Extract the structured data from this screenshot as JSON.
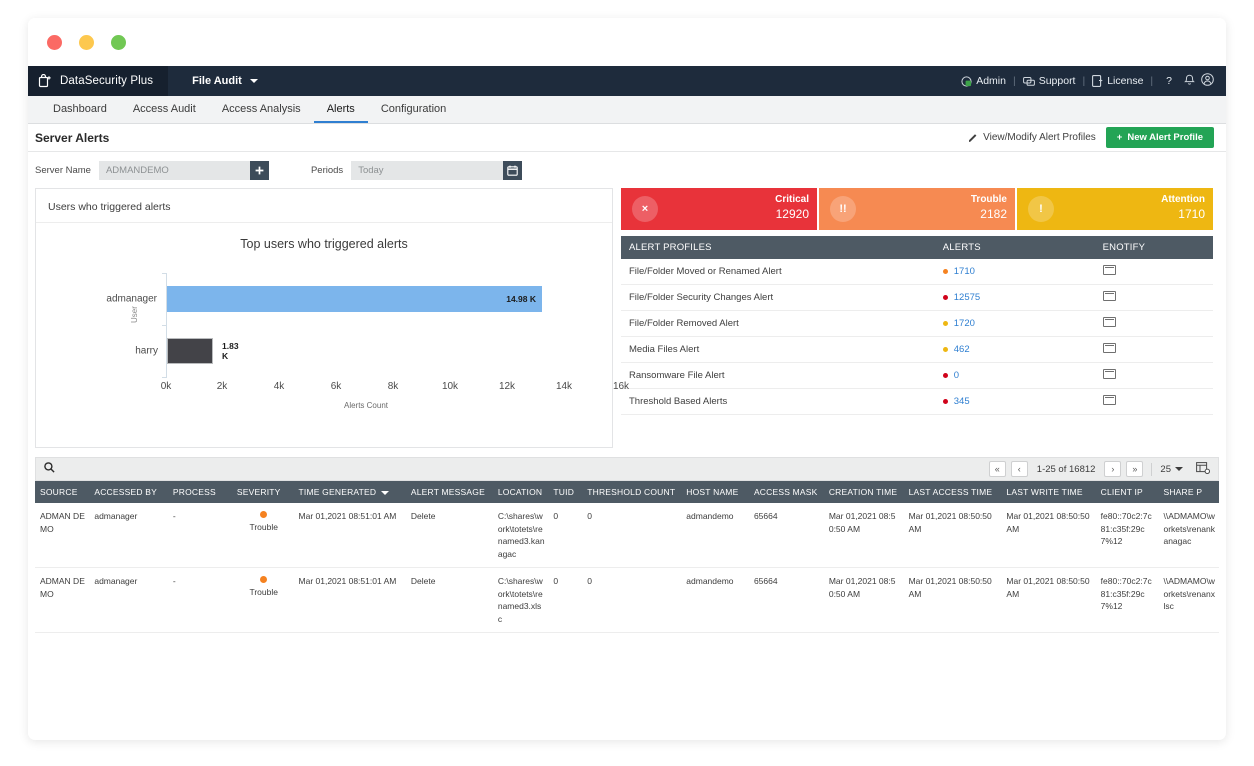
{
  "window": {
    "controls": [
      "close",
      "minimize",
      "maximize"
    ]
  },
  "appbar": {
    "brand": "DataSecurity Plus",
    "module": "File Audit",
    "right_items": [
      {
        "label": "Admin",
        "icon": "admin-icon"
      },
      {
        "label": "Support",
        "icon": "support-icon"
      },
      {
        "label": "License",
        "icon": "license-icon"
      }
    ],
    "help_icon": "?",
    "bell_icon": "bell-icon",
    "user_icon": "user-icon"
  },
  "tabs": [
    {
      "label": "Dashboard",
      "active": false
    },
    {
      "label": "Access Audit",
      "active": false
    },
    {
      "label": "Access Analysis",
      "active": false
    },
    {
      "label": "Alerts",
      "active": true
    },
    {
      "label": "Configuration",
      "active": false
    }
  ],
  "page": {
    "title": "Server Alerts",
    "view_modify_label": "View/Modify Alert Profiles",
    "new_profile_label": "New Alert Profile",
    "accent_green": "#23a455"
  },
  "filters": {
    "server_label": "Server Name",
    "server_value": "ADMANDEMO",
    "server_add_label": "+",
    "periods_label": "Periods",
    "periods_value": "Today"
  },
  "chart_card": {
    "title": "Users who triggered alerts"
  },
  "chart_data": {
    "type": "bar",
    "orientation": "horizontal",
    "title": "Top users who triggered alerts",
    "categories": [
      "admanager",
      "harry"
    ],
    "values": [
      14980,
      1830
    ],
    "data_labels": [
      "14.98 K",
      "1.83 K"
    ],
    "colors": [
      "#7cb5ec",
      "#434348"
    ],
    "xlabel": "Alerts Count",
    "ylabel": "User",
    "xlim": [
      0,
      16000
    ],
    "xticks": [
      "0k",
      "2k",
      "4k",
      "6k",
      "8k",
      "10k",
      "12k",
      "14k",
      "16k"
    ],
    "grid": false,
    "legend": "none"
  },
  "stat_cards": [
    {
      "label": "Critical",
      "value": "12920",
      "color": "#e8333a",
      "icon": "×"
    },
    {
      "label": "Trouble",
      "value": "2182",
      "color": "#f68a52",
      "icon": "!!"
    },
    {
      "label": "Attention",
      "value": "1710",
      "color": "#eeb712",
      "icon": "!"
    }
  ],
  "profiles_table": {
    "headers": [
      "ALERT PROFILES",
      "ALERTS",
      "ENOTIFY"
    ],
    "rows": [
      {
        "profile": "File/Folder Moved or Renamed Alert",
        "alerts": "1710",
        "dot": "#f58220",
        "enotify": "mail-icon"
      },
      {
        "profile": "File/Folder Security Changes Alert",
        "alerts": "12575",
        "dot": "#d0021b",
        "enotify": "mail-icon"
      },
      {
        "profile": "File/Folder Removed Alert",
        "alerts": "1720",
        "dot": "#eeb712",
        "enotify": "mail-icon"
      },
      {
        "profile": "Media Files Alert",
        "alerts": "462",
        "dot": "#eeb712",
        "enotify": "mail-icon"
      },
      {
        "profile": "Ransomware File Alert",
        "alerts": "0",
        "dot": "#d0021b",
        "enotify": "mail-icon"
      },
      {
        "profile": "Threshold Based Alerts",
        "alerts": "345",
        "dot": "#d0021b",
        "enotify": "mail-icon"
      }
    ]
  },
  "data_table": {
    "search_placeholder": "",
    "pagination": {
      "first": "«",
      "prev": "‹",
      "range": "1-25 of 16812",
      "next": "›",
      "last": "»",
      "page_size": "25"
    },
    "headers": [
      "SOURCE",
      "ACCESSED BY",
      "PROCESS",
      "SEVERITY",
      "TIME GENERATED",
      "ALERT MESSAGE",
      "LOCATION",
      "TUID",
      "THRESHOLD COUNT",
      "HOST NAME",
      "ACCESS MASK",
      "CREATION TIME",
      "LAST ACCESS TIME",
      "LAST WRITE TIME",
      "CLIENT IP",
      "SHARE P"
    ],
    "sorted_column": "TIME GENERATED",
    "rows": [
      {
        "source": "ADMAN DEMO",
        "accessed_by": "admanager",
        "process": "-",
        "severity": "Trouble",
        "time_generated": "Mar 01,2021 08:51:01 AM",
        "alert_message": "Delete",
        "location": "C:\\shares\\work\\totets\\renamed3.kanagac",
        "tuid": "0",
        "threshold_count": "0",
        "host_name": "admandemo",
        "access_mask": "65664",
        "creation_time": "Mar 01,2021 08:50:50 AM",
        "last_access_time": "Mar 01,2021 08:50:50 AM",
        "last_write_time": "Mar 01,2021 08:50:50 AM",
        "client_ip": "fe80::70c2:7c81:c35f:29c7%12",
        "share_path": "\\\\ADMAMO\\workets\\renankanagac"
      },
      {
        "source": "ADMAN DEMO",
        "accessed_by": "admanager",
        "process": "-",
        "severity": "Trouble",
        "time_generated": "Mar 01,2021 08:51:01 AM",
        "alert_message": "Delete",
        "location": "C:\\shares\\work\\totets\\renamed3.xlsc",
        "tuid": "0",
        "threshold_count": "0",
        "host_name": "admandemo",
        "access_mask": "65664",
        "creation_time": "Mar 01,2021 08:50:50 AM",
        "last_access_time": "Mar 01,2021 08:50:50 AM",
        "last_write_time": "Mar 01,2021 08:50:50 AM",
        "client_ip": "fe80::70c2:7c81:c35f:29c7%12",
        "share_path": "\\\\ADMAMO\\workets\\renanxlsc"
      }
    ]
  }
}
